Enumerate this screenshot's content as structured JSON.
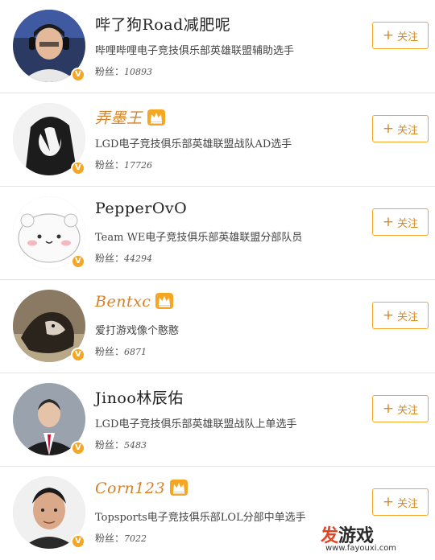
{
  "follow_label": "关注",
  "fans_label": "粉丝：",
  "verified_badge": "V",
  "accent_color": "#f5a623",
  "users": [
    {
      "name": "哔了狗Road减肥呢",
      "vip": false,
      "desc": "哔哩哔哩电子竞技俱乐部英雄联盟辅助选手",
      "fans": "10893",
      "avatar": "player-headset-avatar"
    },
    {
      "name": "弄墨王",
      "vip": true,
      "desc": "LGD电子竞技俱乐部英雄联盟战队AD选手",
      "fans": "17726",
      "avatar": "anime-dark-hair-avatar"
    },
    {
      "name": "PepperOvO",
      "vip": false,
      "desc": "Team WE电子竞技俱乐部英雄联盟分部队员",
      "fans": "44294",
      "avatar": "white-bear-cartoon-avatar"
    },
    {
      "name": "Bentxc",
      "vip": true,
      "desc": "爱打游戏像个憨憨",
      "fans": "6871",
      "avatar": "dog-photo-avatar"
    },
    {
      "name": "Jinoo林辰佑",
      "vip": false,
      "desc": "LGD电子竞技俱乐部英雄联盟战队上单选手",
      "fans": "5483",
      "avatar": "man-in-suit-avatar"
    },
    {
      "name": "Corn123",
      "vip": true,
      "desc": "Topsports电子竞技俱乐部LOL分部中单选手",
      "fans": "7022",
      "avatar": "man-portrait-avatar"
    }
  ],
  "watermark": {
    "main_a": "发",
    "main_b": "游戏",
    "url": "www.fayouxi.com"
  }
}
